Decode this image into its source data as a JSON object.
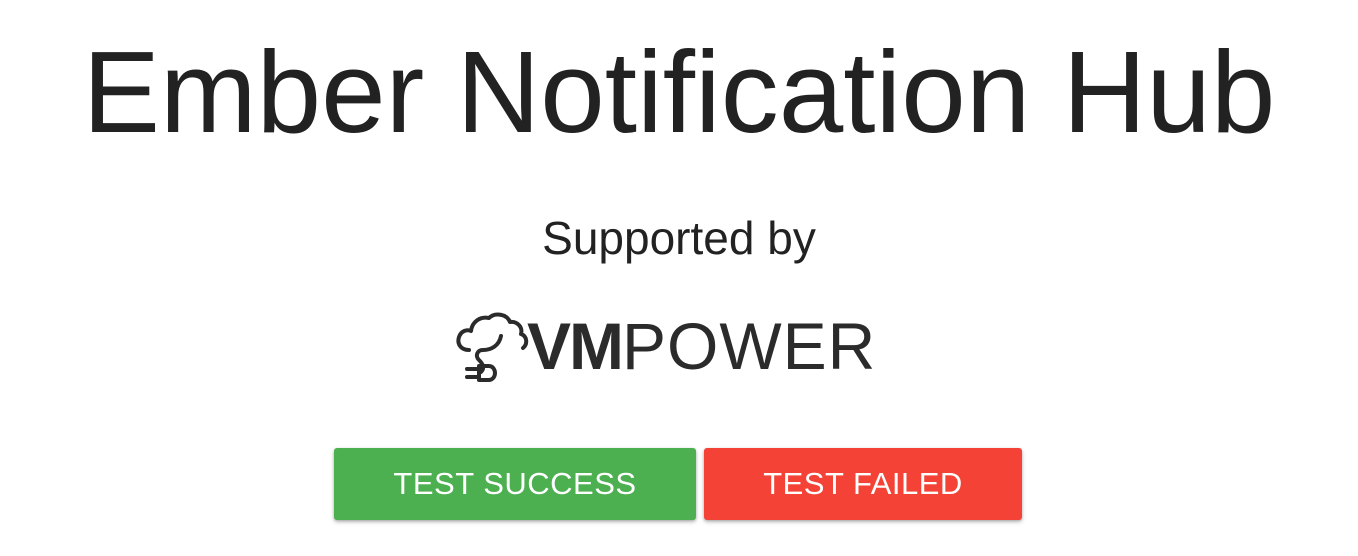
{
  "header": {
    "title": "Ember Notification Hub"
  },
  "sponsor": {
    "label": "Supported by",
    "logo_bold": "VM",
    "logo_light": "POWER",
    "logo_icon": "cloud-plug-icon"
  },
  "actions": {
    "success_label": "TEST SUCCESS",
    "failed_label": "TEST FAILED"
  },
  "colors": {
    "success": "#4caf50",
    "failed": "#f44336",
    "text": "#222222"
  }
}
